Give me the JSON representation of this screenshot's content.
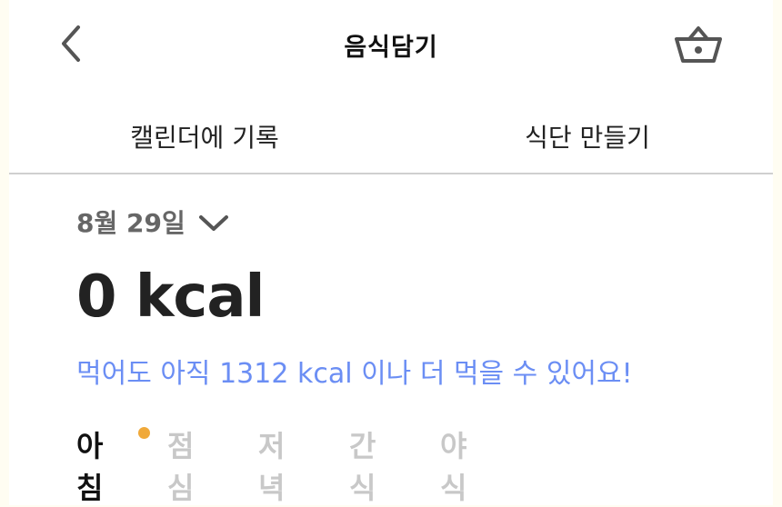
{
  "header": {
    "title": "음식담기",
    "back_icon": "chevron-left-icon",
    "basket_icon": "basket-icon"
  },
  "tabs": [
    {
      "label": "캘린더에 기록"
    },
    {
      "label": "식단 만들기"
    }
  ],
  "date": {
    "label": "8월 29일",
    "dropdown_icon": "chevron-down-icon"
  },
  "summary": {
    "calories": "0 kcal",
    "remaining_message": "먹어도 아직 1312 kcal 이나 더 먹을 수 있어요!"
  },
  "meals": [
    {
      "label": "아침",
      "active": true,
      "has_dot": true
    },
    {
      "label": "점심",
      "active": false
    },
    {
      "label": "저녁",
      "active": false
    },
    {
      "label": "간식",
      "active": false
    },
    {
      "label": "야식",
      "active": false
    }
  ],
  "colors": {
    "accent_blue": "#6b8ef4",
    "dot_orange": "#f0a93a",
    "inactive_gray": "#c8c8c8"
  }
}
